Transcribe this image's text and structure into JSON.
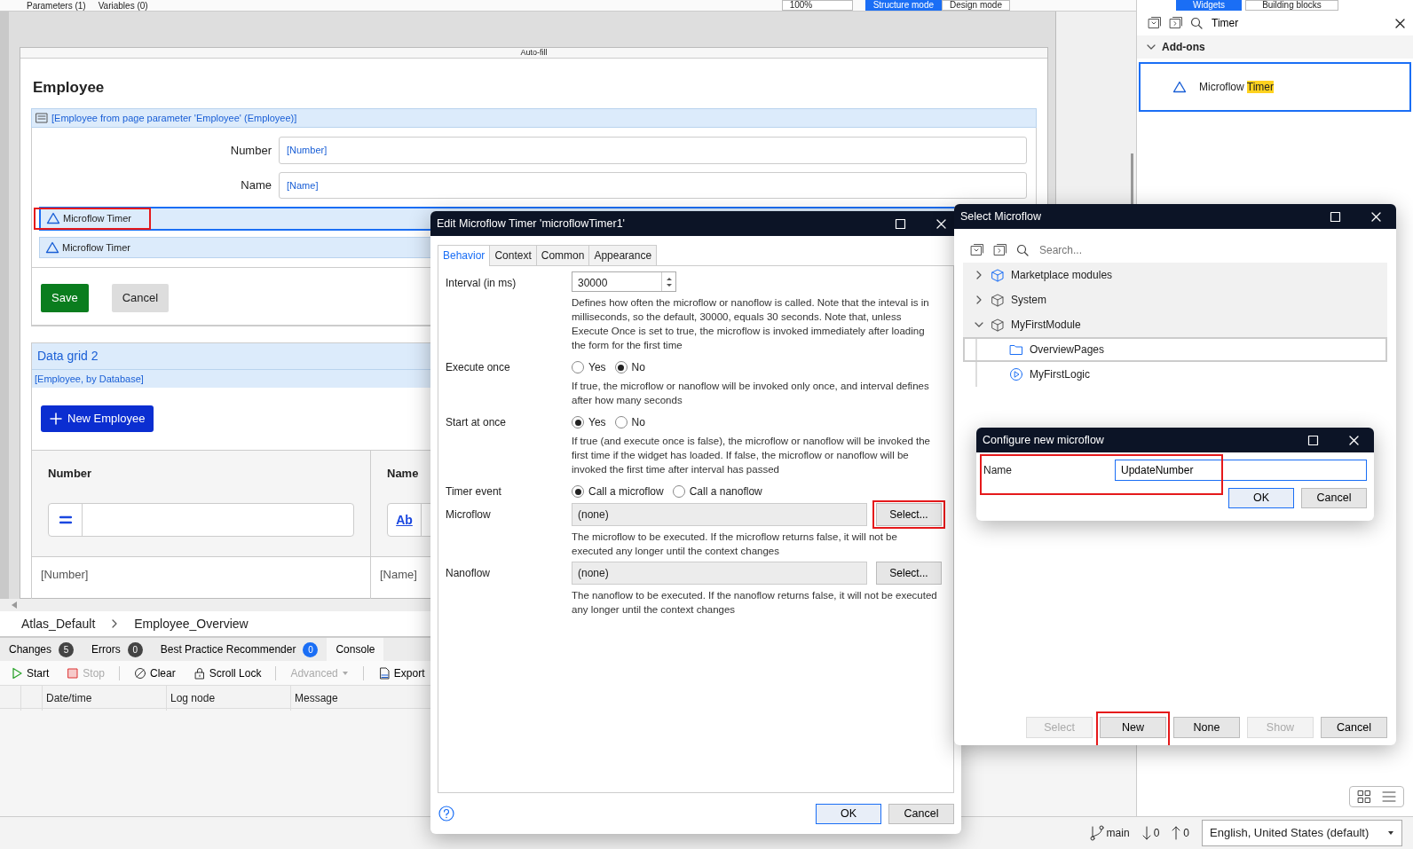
{
  "top_toolbar": {
    "items": [
      {
        "label": "Parameters (1)"
      },
      {
        "label": "Variables (0)"
      }
    ],
    "zoom": "100%",
    "modes": [
      {
        "label": "Structure mode",
        "selected": true
      },
      {
        "label": "Design mode",
        "selected": false
      }
    ]
  },
  "page": {
    "caption": "Auto-fill",
    "title": "Employee",
    "dataview": "[Employee from page parameter 'Employee' (Employee)]",
    "fields": [
      {
        "label": "Number",
        "value": "[Number]"
      },
      {
        "label": "Name",
        "value": "[Name]"
      }
    ],
    "timers": [
      {
        "label": "Microflow Timer",
        "selected": true
      },
      {
        "label": "Microflow Timer",
        "selected": false
      }
    ],
    "buttons": [
      {
        "label": "Save",
        "kind": "success"
      },
      {
        "label": "Cancel",
        "kind": "default"
      }
    ],
    "data_grid": {
      "title": "Data grid 2",
      "source": "[Employee, by Database]",
      "new_button": "New Employee",
      "columns": [
        {
          "label": "Number",
          "kind": "equals"
        },
        {
          "label": "Name",
          "kind": "text",
          "filter_label": "Ab"
        }
      ],
      "rows": [
        [
          "[Number]",
          "[Name]"
        ]
      ]
    }
  },
  "breadcrumb": [
    "Atlas_Default",
    "Employee_Overview"
  ],
  "bottom_panel": {
    "tabs": [
      {
        "label": "Changes",
        "count": "5",
        "color": "#444444",
        "selected": false
      },
      {
        "label": "Errors",
        "count": "0",
        "color": "#444444",
        "selected": false
      },
      {
        "label": "Best Practice Recommender",
        "count": "0",
        "color": "#1a6ef5",
        "selected": false
      },
      {
        "label": "Console",
        "selected": true
      }
    ],
    "toolbar": [
      {
        "label": "Start",
        "kind": "start",
        "disabled": false
      },
      {
        "label": "Stop",
        "kind": "stop",
        "disabled": true
      },
      {
        "label": "Clear",
        "kind": "clear",
        "disabled": false
      },
      {
        "label": "Scroll Lock",
        "kind": "lock",
        "disabled": false
      },
      {
        "label": "Advanced",
        "kind": "dropdown",
        "disabled": true
      },
      {
        "label": "Export",
        "kind": "export",
        "disabled": false
      }
    ],
    "columns": [
      "Date/time",
      "Log node",
      "Message"
    ]
  },
  "right_panel": {
    "tabs": [
      {
        "label": "Widgets",
        "selected": true
      },
      {
        "label": "Building blocks",
        "selected": false
      }
    ],
    "search": {
      "value": "Timer"
    },
    "group": {
      "label": "Add-ons",
      "expanded": true
    },
    "widgets": [
      {
        "selected": true,
        "parts": [
          {
            "text": "Microflow",
            "highlighted": false
          },
          {
            "text": "Timer",
            "highlighted": true
          }
        ]
      }
    ]
  },
  "status_bar": {
    "branch": "main",
    "incoming": "0",
    "outgoing": "0",
    "language": "English, United States (default)"
  },
  "edit_dialog": {
    "title": "Edit Microflow Timer 'microflowTimer1'",
    "tabs": [
      {
        "label": "Behavior",
        "selected": true
      },
      {
        "label": "Context",
        "selected": false
      },
      {
        "label": "Common",
        "selected": false
      },
      {
        "label": "Appearance",
        "selected": false
      }
    ],
    "properties": [
      {
        "label": "Interval (in ms)",
        "kind": "spin",
        "value": "30000",
        "description": "Defines how often the microflow or nanoflow is called. Note that the inteval is in milliseconds, so the default, 30000, equals 30 seconds. Note that, unless Execute Once is set to true, the microflow is invoked immediately after loading the form for the first time"
      },
      {
        "label": "Execute once",
        "kind": "radio",
        "options": [
          {
            "label": "Yes",
            "selected": false
          },
          {
            "label": "No",
            "selected": true
          }
        ],
        "description": "If true, the microflow or nanoflow will be invoked only once, and interval defines after how many seconds"
      },
      {
        "label": "Start at once",
        "kind": "radio",
        "options": [
          {
            "label": "Yes",
            "selected": true
          },
          {
            "label": "No",
            "selected": false
          }
        ],
        "description": "If true (and execute once is false), the microflow or nanoflow will be invoked the first time if the widget has loaded. If false, the microflow or nanoflow will be invoked the first time after interval has passed"
      },
      {
        "label": "Timer event",
        "kind": "radio",
        "options": [
          {
            "label": "Call a microflow",
            "selected": true
          },
          {
            "label": "Call a nanoflow",
            "selected": false
          }
        ]
      },
      {
        "label": "Microflow",
        "kind": "select",
        "value": "(none)",
        "button": "Select...",
        "description": "The microflow to be executed. If the microflow returns false, it will not be executed any longer until the context changes"
      },
      {
        "label": "Nanoflow",
        "kind": "select",
        "value": "(none)",
        "button": "Select...",
        "description": "The nanoflow to be executed. If the nanoflow returns false, it will not be executed any longer until the context changes"
      }
    ],
    "buttons": [
      {
        "label": "OK",
        "primary": true
      },
      {
        "label": "Cancel",
        "primary": false
      }
    ]
  },
  "select_dialog": {
    "title": "Select Microflow",
    "search": {
      "placeholder": "Search..."
    },
    "tree": [
      {
        "label": "Marketplace modules",
        "kind": "marketplace",
        "expanded": false
      },
      {
        "label": "System",
        "kind": "system",
        "expanded": false
      },
      {
        "label": "MyFirstModule",
        "kind": "module",
        "expanded": true,
        "children": [
          {
            "label": "OverviewPages",
            "kind": "folder",
            "selected": true
          },
          {
            "label": "MyFirstLogic",
            "kind": "flow",
            "selected": false
          }
        ]
      }
    ],
    "buttons": [
      {
        "label": "Select",
        "disabled": true
      },
      {
        "label": "New",
        "disabled": false
      },
      {
        "label": "None",
        "disabled": false
      },
      {
        "label": "Show",
        "disabled": true
      },
      {
        "label": "Cancel",
        "disabled": false
      }
    ]
  },
  "configure_dialog": {
    "title": "Configure new microflow",
    "field": {
      "label": "Name",
      "value": "UpdateNumber"
    },
    "buttons": [
      {
        "label": "OK",
        "primary": true
      },
      {
        "label": "Cancel",
        "primary": false
      }
    ]
  }
}
